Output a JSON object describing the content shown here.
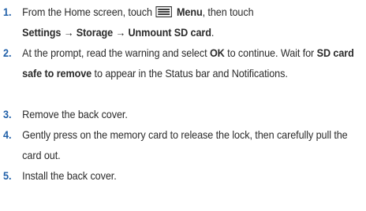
{
  "steps": [
    {
      "number": "1.",
      "parts": {
        "a": "From the Home screen, touch",
        "menu_label": "Menu",
        "b": ", then touch",
        "path": "Settings → Storage → Unmount SD card",
        "c": "."
      }
    },
    {
      "number": "2.",
      "parts": {
        "a": "At the prompt, read the warning and select",
        "ok": "OK",
        "b": "to continue. Wait for",
        "safe": "SD card safe to remove",
        "c": "to appear in the Status bar and Notifications."
      }
    },
    {
      "number": "3.",
      "text": "Remove the back cover."
    },
    {
      "number": "4.",
      "text": "Gently press on the memory card to release the lock, then carefully pull the card out."
    },
    {
      "number": "5.",
      "text": "Install the back cover."
    }
  ],
  "icons": {
    "menu": "menu-icon"
  },
  "colors": {
    "step_number": "#1f5fa8",
    "text": "#2b2b2b"
  }
}
